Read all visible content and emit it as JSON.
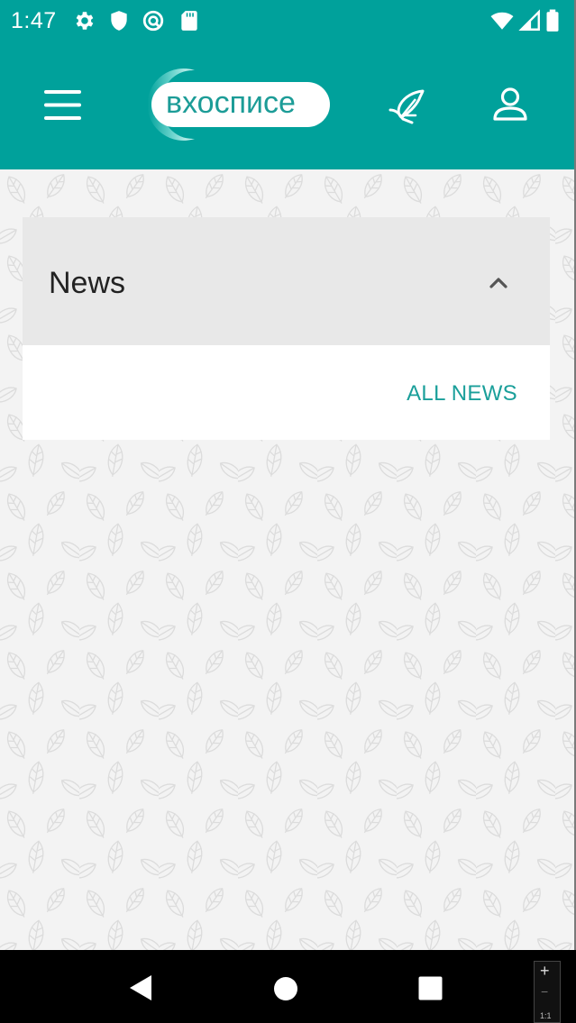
{
  "status": {
    "time": "1:47",
    "icons_left": [
      "settings-icon",
      "shield-icon",
      "vpn-icon",
      "sdcard-icon"
    ],
    "icons_right": [
      "wifi-icon",
      "cell-signal-icon",
      "battery-icon"
    ]
  },
  "appbar": {
    "logo_text": "вхосписе",
    "left_icon": "menu-icon",
    "right_icons": [
      "leaf-hand-icon",
      "profile-icon"
    ],
    "color": "#00a19b"
  },
  "news_card": {
    "title": "News",
    "expanded": true,
    "link_label": "ALL NEWS",
    "link_color": "#1a9f9a"
  },
  "navbar": {
    "buttons": [
      "back-button",
      "home-button",
      "recents-button"
    ],
    "zoom": {
      "plus": "+",
      "minus": "−",
      "ratio": "1:1"
    }
  }
}
